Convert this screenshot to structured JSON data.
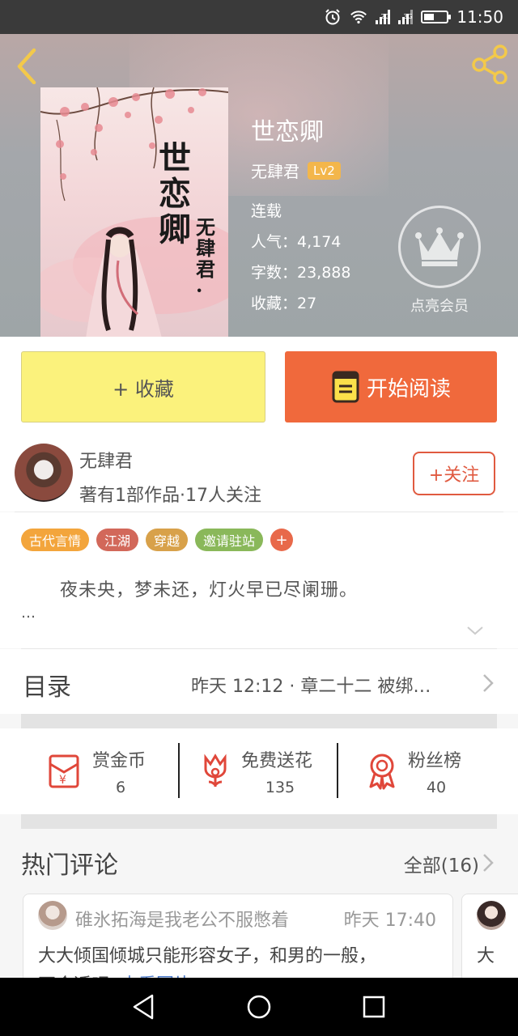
{
  "status_bar": {
    "time": "11:50",
    "net1": "2G",
    "net2": "3G"
  },
  "book": {
    "title": "世恋卿",
    "author": "无肆君",
    "level": "Lv2",
    "status": "连载",
    "popularity_label": "人气：4,174",
    "words_label": "字数：23,888",
    "favorites_label": "收藏：27",
    "cover_title": "世恋卿",
    "cover_author": "无肆君·"
  },
  "vip": {
    "label": "点亮会员"
  },
  "actions": {
    "collect": "+ 收藏",
    "read": "开始阅读"
  },
  "author_card": {
    "name": "无肆君",
    "stats": "著有1部作品·17人关注",
    "follow": "+关注"
  },
  "tags": [
    {
      "label": "古代言情",
      "color": "#f3a53c"
    },
    {
      "label": "江湖",
      "color": "#d2685a"
    },
    {
      "label": "穿越",
      "color": "#d8a14a"
    },
    {
      "label": "邀请驻站",
      "color": "#8ab85a"
    }
  ],
  "tag_plus": "+",
  "description": "夜未央，梦未还，灯火早已尽阑珊。",
  "ellipsis": "…",
  "toc": {
    "label": "目录",
    "latest": "昨天 12:12 · 章二十二 被绑…"
  },
  "stats": {
    "reward": {
      "label": "赏金币",
      "value": "6"
    },
    "flowers": {
      "label": "免费送花",
      "value": "135"
    },
    "fans": {
      "label": "粉丝榜",
      "value": "40"
    }
  },
  "comments": {
    "title": "热门评论",
    "all": "全部(16)",
    "items": [
      {
        "user": "碓氷拓海是我老公不服憋着",
        "time": "昨天 17:40",
        "text": "大大倾国倾城只能形容女子，和男的一般，",
        "more": "不合适吧",
        "link": "查看图片"
      },
      {
        "text": "大"
      }
    ]
  },
  "colors": {
    "accent_orange": "#f0693c",
    "collect_yellow": "#fbf27c",
    "header_icon": "#f3c94a"
  }
}
